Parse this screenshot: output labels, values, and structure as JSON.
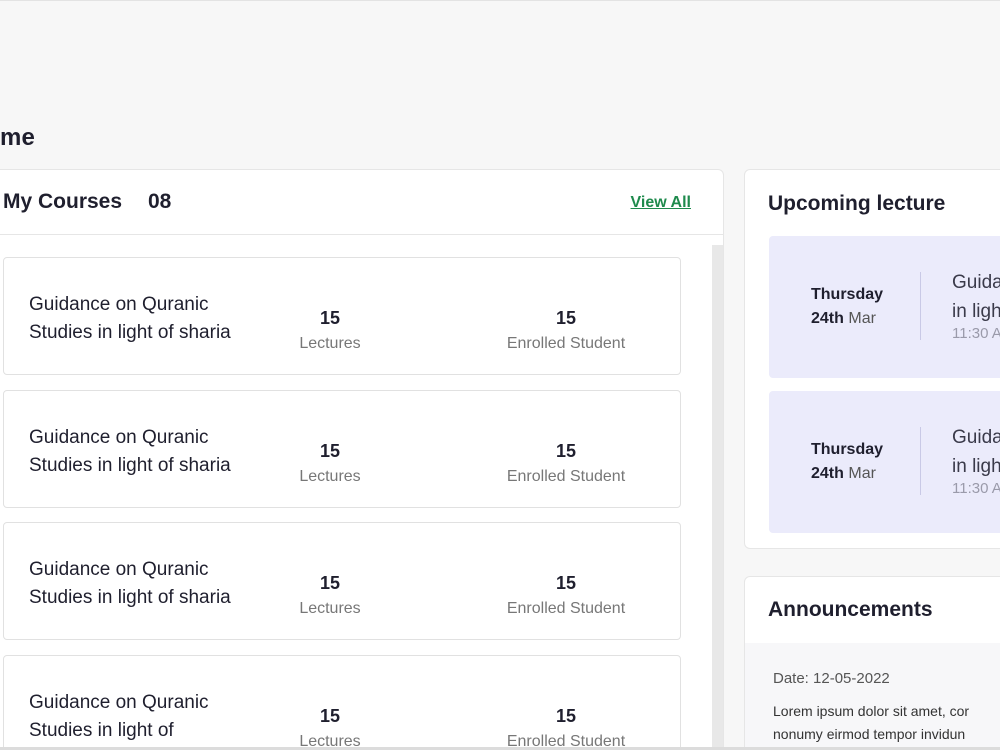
{
  "page": {
    "title": "me"
  },
  "courses": {
    "title": "My Courses",
    "count": "08",
    "view_all_label": "View All",
    "items": [
      {
        "name": "Guidance on Quranic Studies in light of sharia",
        "lectures": "15",
        "lectures_label": "Lectures",
        "enrolled": "15",
        "enrolled_label": "Enrolled Student"
      },
      {
        "name": "Guidance on Quranic Studies in light of sharia",
        "lectures": "15",
        "lectures_label": "Lectures",
        "enrolled": "15",
        "enrolled_label": "Enrolled Student"
      },
      {
        "name": "Guidance on Quranic Studies in light of sharia",
        "lectures": "15",
        "lectures_label": "Lectures",
        "enrolled": "15",
        "enrolled_label": "Enrolled Student"
      },
      {
        "name": "Guidance on Quranic Studies in light of",
        "lectures": "15",
        "lectures_label": "Lectures",
        "enrolled": "15",
        "enrolled_label": "Enrolled Student"
      }
    ]
  },
  "upcoming": {
    "title": "Upcoming lecture",
    "items": [
      {
        "day": "Thursday",
        "date_num": "24th",
        "month": "Mar",
        "topic_line1": "Guida",
        "topic_line2": "in ligh",
        "time": "11:30 A"
      },
      {
        "day": "Thursday",
        "date_num": "24th",
        "month": "Mar",
        "topic_line1": "Guida",
        "topic_line2": "in ligh",
        "time": "11:30 A"
      }
    ]
  },
  "announcements": {
    "title": "Announcements",
    "date": "Date: 12-05-2022",
    "text_line1": "Lorem ipsum dolor sit amet, cor",
    "text_line2": "nonumy eirmod tempor invidun"
  },
  "colors": {
    "accent_green": "#1e8a4c",
    "lecture_bg": "#ebebfb",
    "page_bg": "#f7f7f7"
  }
}
